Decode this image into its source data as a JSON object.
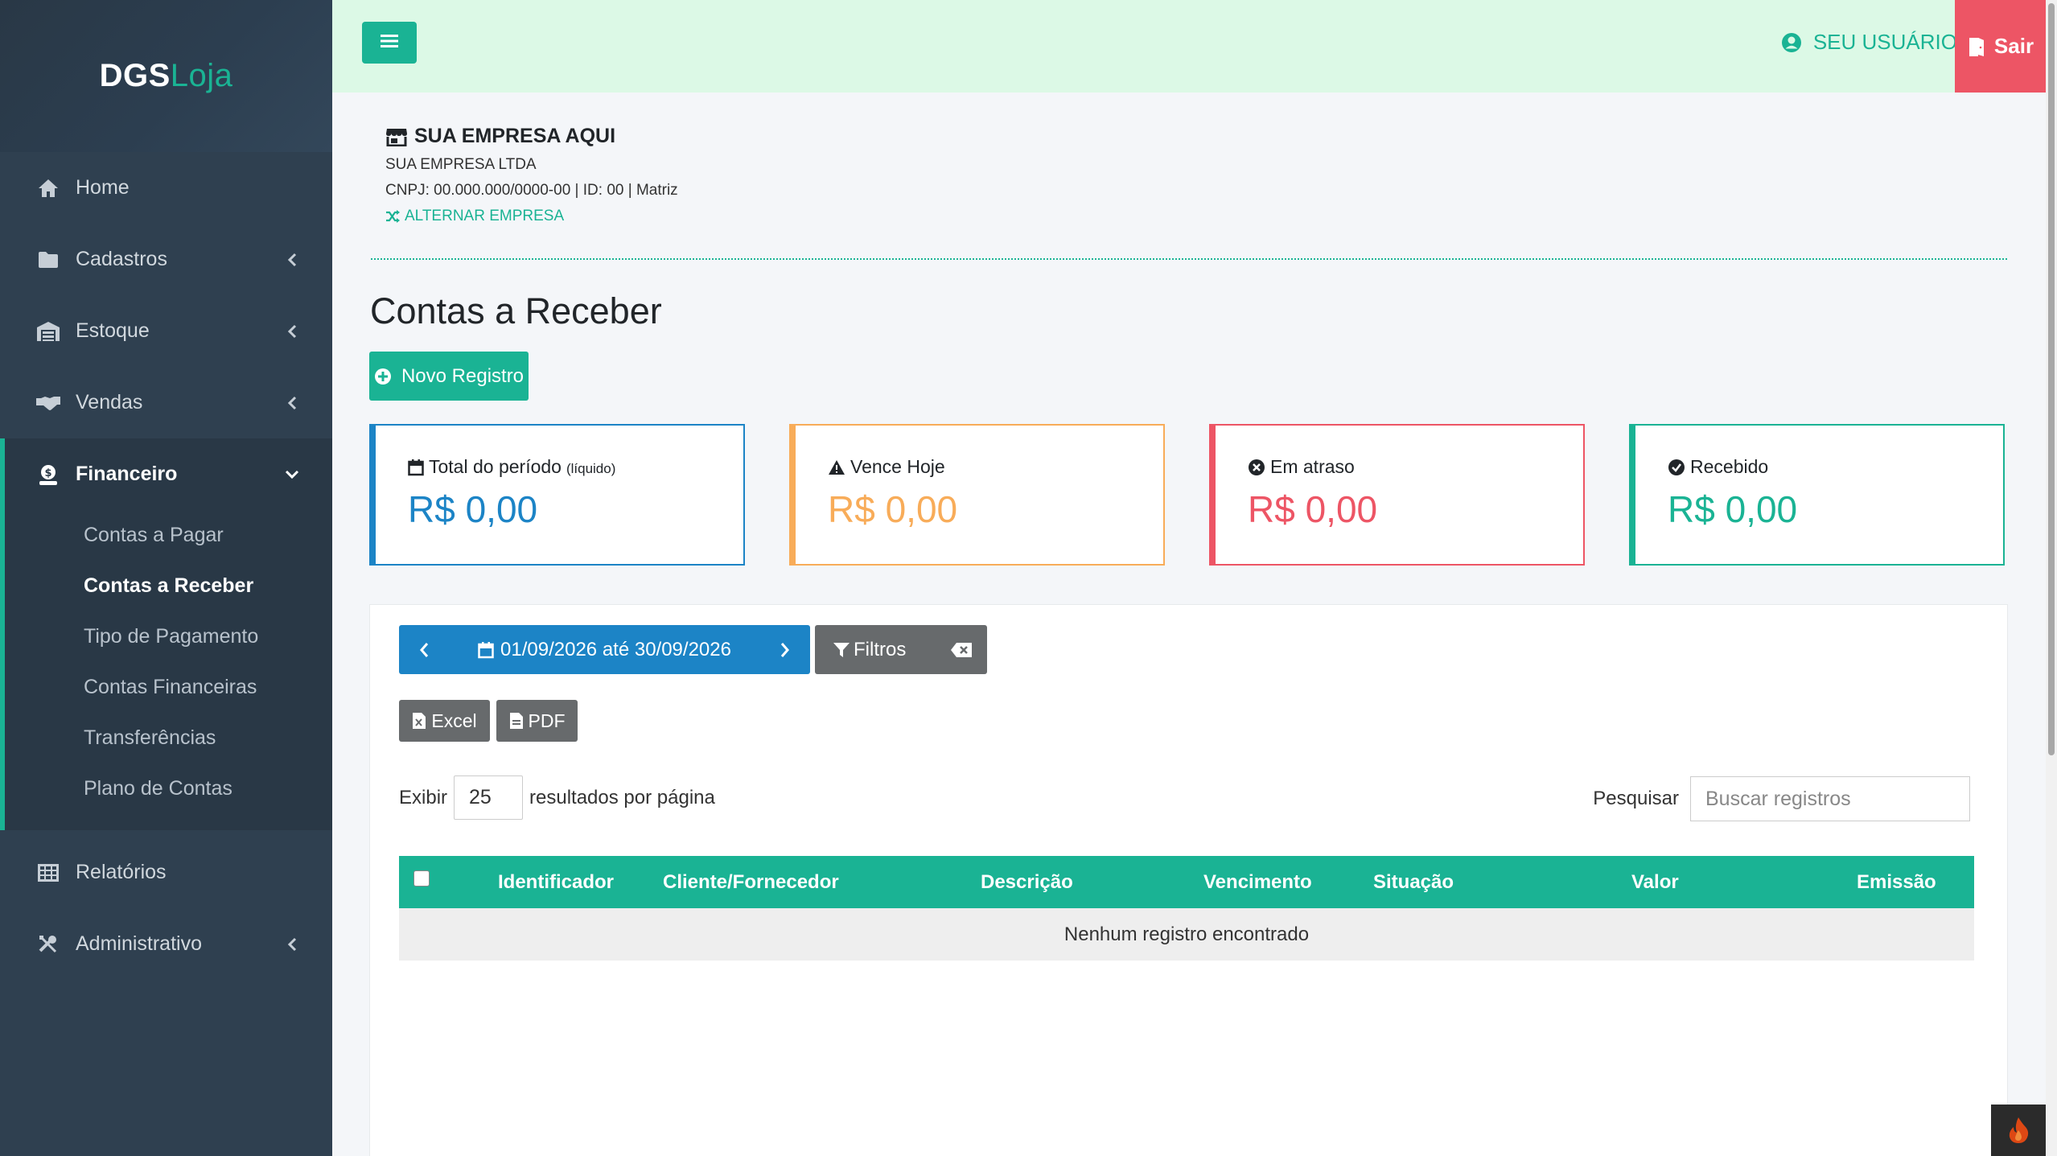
{
  "brand": {
    "part1": "DGS",
    "part2": "Loja"
  },
  "sidebar": {
    "items": [
      {
        "label": "Home",
        "icon": "home-icon"
      },
      {
        "label": "Cadastros",
        "icon": "folder-icon"
      },
      {
        "label": "Estoque",
        "icon": "warehouse-icon"
      },
      {
        "label": "Vendas",
        "icon": "handshake-icon"
      },
      {
        "label": "Financeiro",
        "icon": "money-icon"
      },
      {
        "label": "Relatórios",
        "icon": "table-icon"
      },
      {
        "label": "Administrativo",
        "icon": "tools-icon"
      }
    ],
    "financeiro_sub": [
      {
        "label": "Contas a Pagar"
      },
      {
        "label": "Contas a Receber"
      },
      {
        "label": "Tipo de Pagamento"
      },
      {
        "label": "Contas Financeiras"
      },
      {
        "label": "Transferências"
      },
      {
        "label": "Plano de Contas"
      }
    ]
  },
  "topbar": {
    "user_label": "SEU USUÁRIO",
    "logout_label": "Sair"
  },
  "company": {
    "name": "SUA EMPRESA AQUI",
    "legal_name": "SUA EMPRESA LTDA",
    "details": "CNPJ: 00.000.000/0000-00 | ID: 00 | Matriz",
    "switch_label": "ALTERNAR EMPRESA"
  },
  "page": {
    "title": "Contas a Receber",
    "new_button": "Novo Registro"
  },
  "cards": [
    {
      "title": "Total do período",
      "note": "(líquido)",
      "value": "R$ 0,00",
      "color": "#1c84c6",
      "icon": "calendar-icon"
    },
    {
      "title": "Vence Hoje",
      "note": "",
      "value": "R$ 0,00",
      "color": "#f8ac59",
      "icon": "warning-icon"
    },
    {
      "title": "Em atraso",
      "note": "",
      "value": "R$ 0,00",
      "color": "#ed5565",
      "icon": "times-circle-icon"
    },
    {
      "title": "Recebido",
      "note": "",
      "value": "R$ 0,00",
      "color": "#1ab394",
      "icon": "check-circle-icon"
    }
  ],
  "toolbar": {
    "date_range": "01/09/2026 até 30/09/2026",
    "filters_label": "Filtros",
    "excel_label": "Excel",
    "pdf_label": "PDF"
  },
  "table_controls": {
    "show_label": "Exibir",
    "page_size": "25",
    "per_page_label": "resultados por página",
    "search_label": "Pesquisar",
    "search_placeholder": "Buscar registros"
  },
  "table": {
    "columns": [
      "Identificador",
      "Cliente/Fornecedor",
      "Descrição",
      "Vencimento",
      "Situação",
      "Valor",
      "Emissão"
    ],
    "empty_message": "Nenhum registro encontrado"
  },
  "colors": {
    "accent": "#1ab394",
    "primary": "#1c84c6",
    "danger": "#ed5565",
    "warning": "#f8ac59",
    "sidebar": "#2f4050",
    "topbar": "#dcf9e6"
  }
}
